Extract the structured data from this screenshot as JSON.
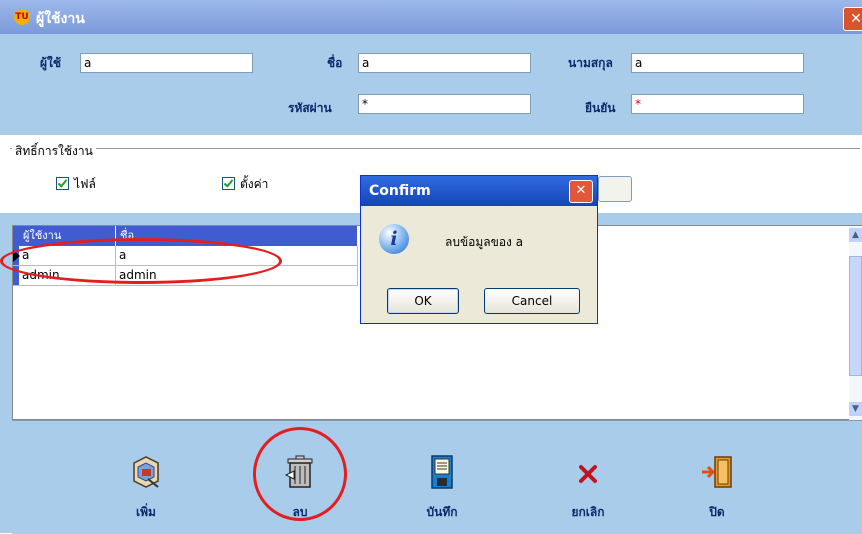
{
  "window": {
    "title": "ผู้ใช้งาน",
    "close_symbol": "✕",
    "app_icon_text": "TU"
  },
  "form": {
    "user_label": "ผู้ใช้",
    "user_value": "a",
    "name_label": "ชื่อ",
    "name_value": "a",
    "surname_label": "นามสกุล",
    "surname_value": "a",
    "password_label": "รหัสผ่าน",
    "password_value": "*",
    "confirm_label": "ยืนยัน",
    "confirm_value": "*"
  },
  "permissions": {
    "group_title": "สิทธิ์การใช้งาน",
    "items": [
      {
        "label": "ไฟล์",
        "checked": true
      },
      {
        "label": "ตั้งค่า",
        "checked": true
      }
    ]
  },
  "grid": {
    "columns": [
      "ผู้ใช้งาน",
      "ชื่อ"
    ],
    "rows": [
      {
        "user": "a",
        "name": "a",
        "selected": true
      },
      {
        "user": "admin",
        "name": "admin",
        "selected": false
      }
    ]
  },
  "toolbar": {
    "add_label": "เพิ่ม",
    "delete_label": "ลบ",
    "save_label": "บันทึก",
    "cancel_label": "ยกเลิก",
    "close_label": "ปิด"
  },
  "dialog": {
    "title": "Confirm",
    "close_symbol": "✕",
    "icon_glyph": "i",
    "message": "ลบข้อมูลของ a",
    "ok_label": "OK",
    "cancel_label": "Cancel"
  },
  "colors": {
    "accent_blue": "#3f5dcf",
    "panel": "#A9CCEB",
    "highlight_ring": "#e41e1e"
  }
}
